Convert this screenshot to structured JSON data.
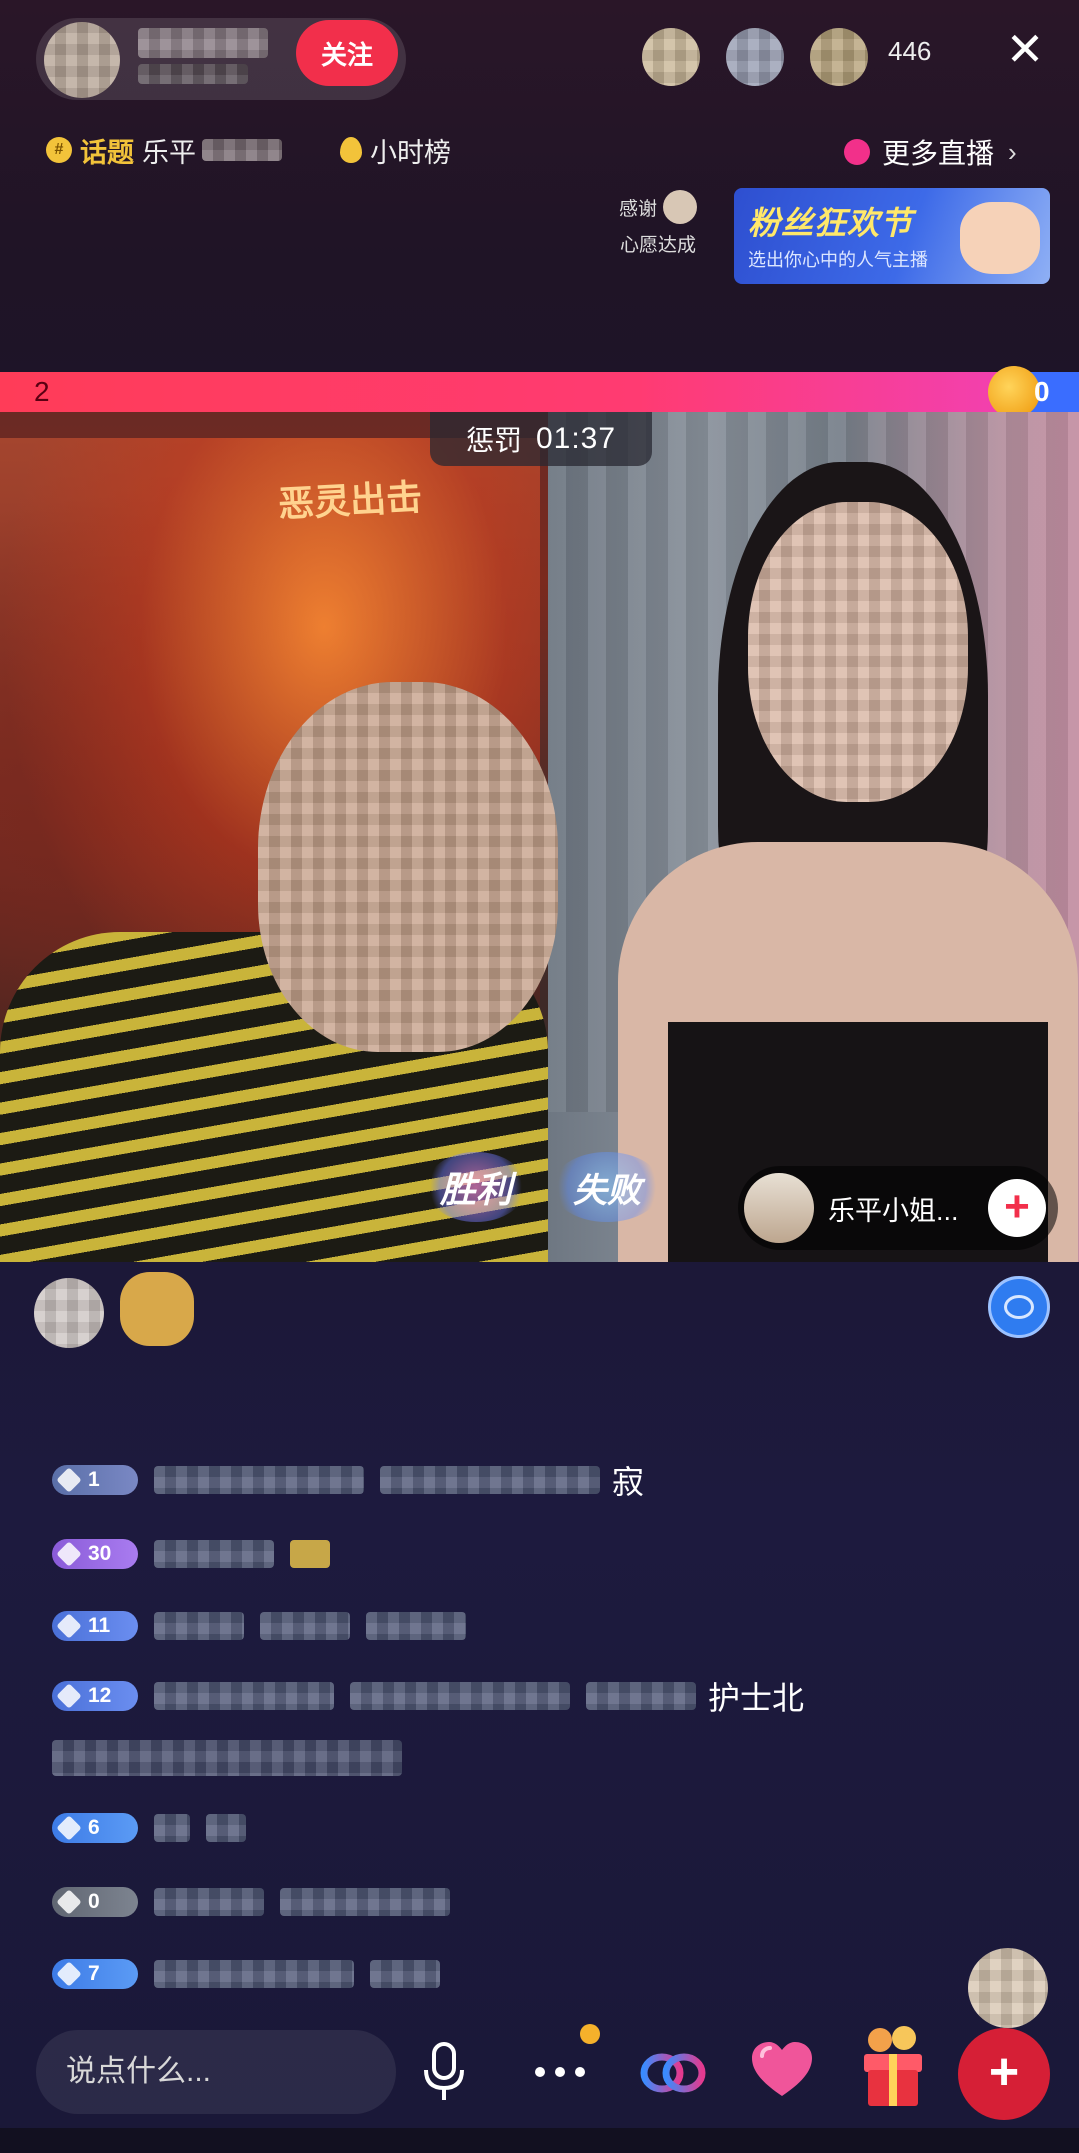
{
  "header": {
    "follow_label": "关注",
    "viewer_count": "446",
    "close_glyph": "✕"
  },
  "tags": {
    "topic_label": "话题",
    "topic_text": "乐平",
    "hour_rank": "小时榜",
    "more_live": "更多直播",
    "more_chevron": "›"
  },
  "task": {
    "line1": "感谢",
    "line2": "心愿达成"
  },
  "banner": {
    "title": "粉丝狂欢节",
    "subtitle": "选出你心中的人气主播"
  },
  "pk": {
    "left_score": "2",
    "right_score": "0",
    "penalty_label": "惩罚",
    "penalty_time": "01:37",
    "win_badge": "胜利",
    "lose_badge": "失败"
  },
  "video": {
    "poster_title": "恶灵出击"
  },
  "guest": {
    "name": "乐平小姐...",
    "add_glyph": "+"
  },
  "chat": {
    "messages": [
      {
        "level": "1",
        "tail": "寂"
      },
      {
        "level": "30",
        "tail": ""
      },
      {
        "level": "11",
        "tail": ""
      },
      {
        "level": "12",
        "tail": "护士北"
      },
      {
        "level": "6",
        "tail": ""
      },
      {
        "level": "0",
        "tail": ""
      },
      {
        "level": "7",
        "tail": ""
      }
    ]
  },
  "bottom": {
    "input_placeholder": "说点什么...",
    "add_glyph": "+"
  },
  "colors": {
    "follow_red": "#f22f4b",
    "pk_pink": "#ff3c58",
    "pk_blue": "#3a6dff",
    "gold": "#f2c33a"
  }
}
